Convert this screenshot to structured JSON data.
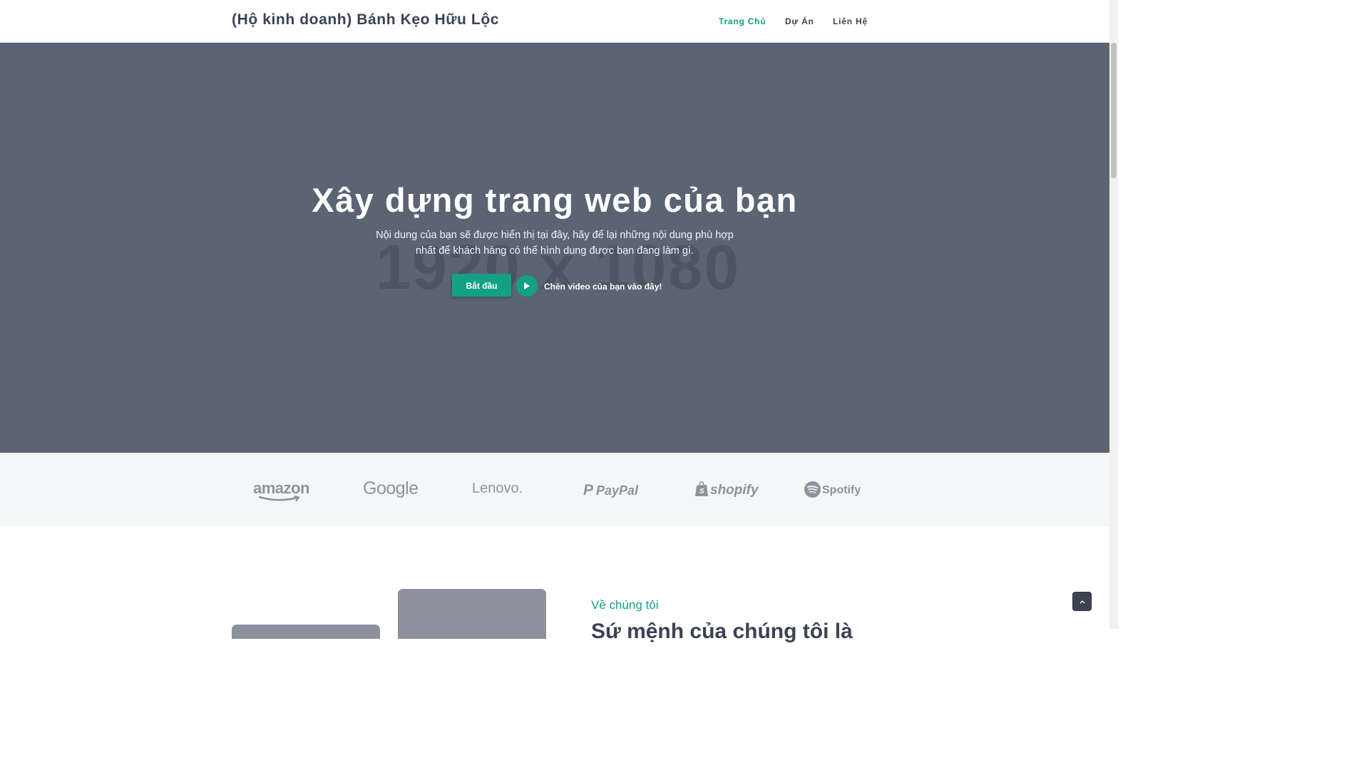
{
  "header": {
    "brand": "(Hộ kinh doanh) Bánh Kẹo Hữu Lộc",
    "nav": [
      {
        "label": "Trang Chủ",
        "active": true
      },
      {
        "label": "Dự Án",
        "active": false
      },
      {
        "label": "Liên Hệ",
        "active": false
      }
    ]
  },
  "hero": {
    "placeholder_text": "1920 x 1080",
    "title": "Xây dựng trang web của bạn",
    "subtitle": "Nội dung của bạn sẽ được hiển thị tại đây, hãy để lại những nội dung phù hợp nhất để khách hàng có thể hình dung được bạn đang làm gì.",
    "start_button": "Bắt đầu",
    "video_text": "Chèn video của bạn vào đây!",
    "play_icon": "play-icon"
  },
  "logos": [
    {
      "name": "amazon",
      "text": "amazon"
    },
    {
      "name": "google",
      "text": "Google"
    },
    {
      "name": "lenovo",
      "text": "Lenovo."
    },
    {
      "name": "paypal",
      "text": "PayPal"
    },
    {
      "name": "shopify",
      "text": "shopify"
    },
    {
      "name": "spotify",
      "text": "Spotify"
    }
  ],
  "about": {
    "label": "Về chúng tôi",
    "heading": "Sứ mệnh của chúng tôi là"
  },
  "scroll_top_icon": "chevron-up-icon",
  "colors": {
    "accent": "#13a184",
    "hero_bg": "#5b6473",
    "text_dark": "#3a4352",
    "logo_gray": "#8d939c",
    "logos_bg": "#f5f6f8"
  }
}
